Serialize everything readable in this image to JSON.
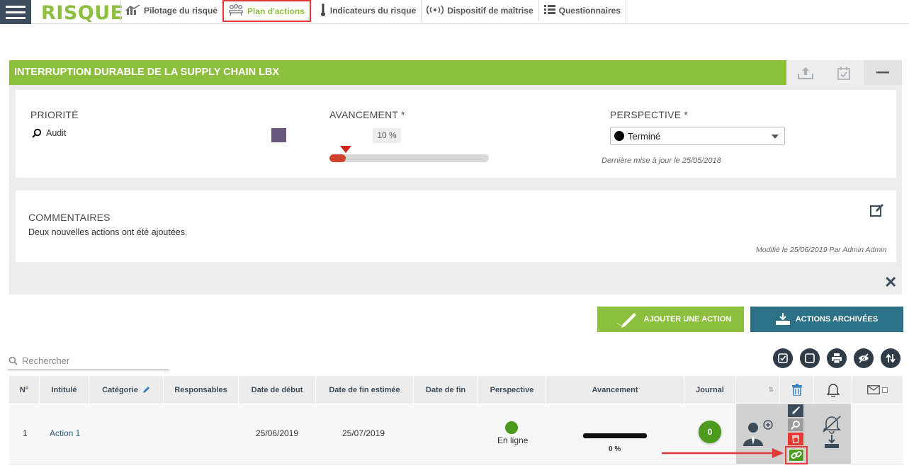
{
  "app": {
    "brand": "RISQUE"
  },
  "nav": {
    "tabs": [
      {
        "label": "Pilotage du risque",
        "icon": "bar-chart-icon"
      },
      {
        "label": "Plan d'actions",
        "icon": "people-meeting-icon",
        "active": true
      },
      {
        "label": "Indicateurs du risque",
        "icon": "thermometer-icon"
      },
      {
        "label": "Dispositif de maîtrise",
        "icon": "broadcast-icon"
      },
      {
        "label": "Questionnaires",
        "icon": "list-icon"
      }
    ]
  },
  "risk": {
    "title": "INTERRUPTION DURABLE DE LA SUPPLY CHAIN LBX",
    "priority": {
      "label": "PRIORITÉ",
      "value": "Audit",
      "color": "#6a577e"
    },
    "progress": {
      "label": "AVANCEMENT *",
      "value_text": "10 %",
      "percent": 10
    },
    "perspective": {
      "label": "PERSPECTIVE *",
      "value": "Terminé",
      "last_update": "Dernière mise à jour le 25/05/2018"
    },
    "comments": {
      "label": "COMMENTAIRES",
      "text": "Deux nouvelles actions ont été ajoutées.",
      "modified": "Modifié le 25/06/2019 Par Admin Admin"
    }
  },
  "actions": {
    "add_label": "AJOUTER UNE ACTION",
    "archived_label": "ACTIONS ARCHIVÉES",
    "search_placeholder": "Rechercher"
  },
  "table": {
    "headers": {
      "num": "N°",
      "title": "Intitulé",
      "category": "Catégorie",
      "owners": "Responsables",
      "start": "Date de début",
      "est_end": "Date de fin estimée",
      "end": "Date de fin",
      "perspective": "Perspective",
      "progress": "Avancement",
      "journal": "Journal"
    },
    "rows": [
      {
        "num": "1",
        "title": "Action 1",
        "category": "",
        "owners": "",
        "start": "25/06/2019",
        "est_end": "25/07/2019",
        "end": "",
        "perspective": "En ligne",
        "progress_text": "0 %",
        "journal": "0"
      }
    ]
  },
  "colors": {
    "accent": "#8dbf3f",
    "dark": "#2f3c48",
    "teal": "#2d7187",
    "danger": "#e53935"
  }
}
